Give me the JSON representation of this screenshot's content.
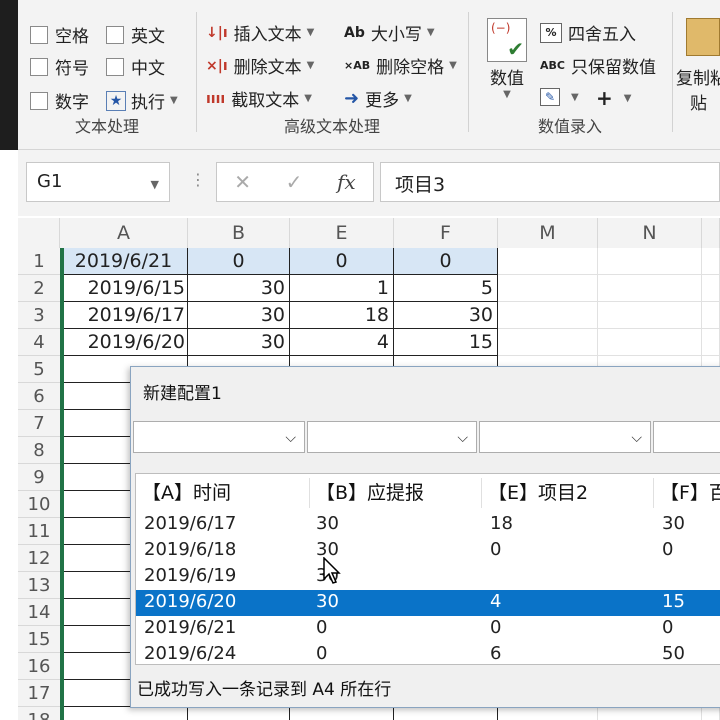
{
  "ribbon": {
    "text_group": {
      "label": "文本处理",
      "checkboxes": [
        {
          "label": "空格"
        },
        {
          "label": "英文"
        },
        {
          "label": "符号"
        },
        {
          "label": "中文"
        },
        {
          "label": "数字"
        }
      ],
      "execute_label": "执行"
    },
    "advanced_group": {
      "label": "高级文本处理",
      "insert_text": "插入文本",
      "delete_text": "删除文本",
      "extract_text": "截取文本",
      "case_label": "大小写",
      "delete_space": "删除空格",
      "more": "更多"
    },
    "number_group": {
      "label": "数值录入",
      "value_label": "数值",
      "round_label": "四舍五入",
      "keep_value_label": "只保留数值",
      "copy_label_line1": "复制粘",
      "copy_label_line2": "贴"
    }
  },
  "formula_bar": {
    "name_box": "G1",
    "formula_value": "项目3"
  },
  "sheet": {
    "columns": [
      "A",
      "B",
      "E",
      "F",
      "M",
      "N"
    ],
    "rows": [
      "1",
      "2",
      "3",
      "4",
      "5",
      "6",
      "7",
      "8",
      "9",
      "10",
      "11",
      "12",
      "13",
      "14",
      "15",
      "16",
      "17",
      "18"
    ],
    "data": [
      [
        "2019/6/21",
        "0",
        "0",
        "0"
      ],
      [
        "2019/6/15",
        "30",
        "1",
        "5"
      ],
      [
        "2019/6/17",
        "30",
        "18",
        "30"
      ],
      [
        "2019/6/20",
        "30",
        "4",
        "15"
      ]
    ]
  },
  "dialog": {
    "title": "新建配置1",
    "headers": [
      "【A】时间",
      "【B】应提报",
      "【E】项目2",
      "【F】百"
    ],
    "rows": [
      [
        "2019/6/17",
        "30",
        "18",
        "30"
      ],
      [
        "2019/6/18",
        "30",
        "0",
        "0"
      ],
      [
        "2019/6/19",
        "30",
        "",
        ""
      ],
      [
        "2019/6/20",
        "30",
        "4",
        "15"
      ],
      [
        "2019/6/21",
        "0",
        "0",
        "0"
      ],
      [
        "2019/6/24",
        "0",
        "6",
        "50"
      ]
    ],
    "selected_row_index": 3,
    "status": "已成功写入一条记录到 A4 所在行"
  },
  "colors": {
    "excel_green": "#217346",
    "selection_blue": "#0a73c8",
    "header_highlight": "#d7e6f5"
  }
}
